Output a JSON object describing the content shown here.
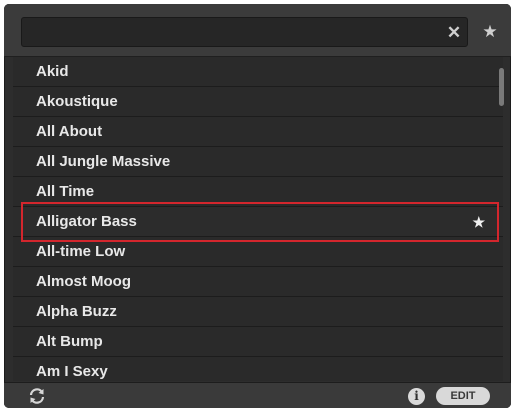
{
  "search": {
    "value": "",
    "placeholder": "",
    "clear_icon": "close-icon",
    "favorites_icon": "star-icon"
  },
  "list": {
    "items": [
      {
        "label": "Akid",
        "favorite": false
      },
      {
        "label": "Akoustique",
        "favorite": false
      },
      {
        "label": "All About",
        "favorite": false
      },
      {
        "label": "All Jungle Massive",
        "favorite": false
      },
      {
        "label": "All Time",
        "favorite": false
      },
      {
        "label": "Alligator Bass",
        "favorite": true
      },
      {
        "label": "All-time Low",
        "favorite": false
      },
      {
        "label": "Almost Moog",
        "favorite": false
      },
      {
        "label": "Alpha Buzz",
        "favorite": false
      },
      {
        "label": "Alt Bump",
        "favorite": false
      },
      {
        "label": "Am I Sexy",
        "favorite": false
      }
    ],
    "highlighted_index": 5,
    "highlight_color": "#d3262d"
  },
  "footer": {
    "sync_icon": "sync-icon",
    "info_icon": "info-icon",
    "info_label": "i",
    "edit_label": "EDIT"
  }
}
